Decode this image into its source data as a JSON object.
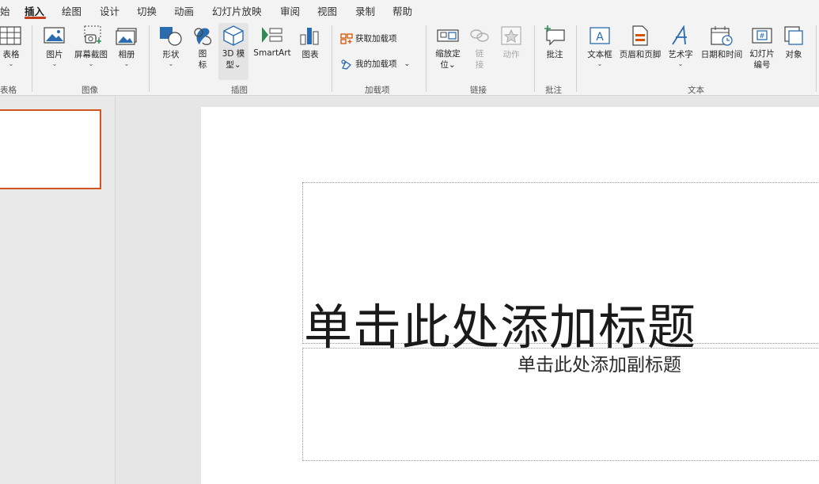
{
  "tabs": [
    {
      "label": "始",
      "active": false
    },
    {
      "label": "插入",
      "active": true
    },
    {
      "label": "绘图",
      "active": false
    },
    {
      "label": "设计",
      "active": false
    },
    {
      "label": "切换",
      "active": false
    },
    {
      "label": "动画",
      "active": false
    },
    {
      "label": "幻灯片放映",
      "active": false
    },
    {
      "label": "审阅",
      "active": false
    },
    {
      "label": "视图",
      "active": false
    },
    {
      "label": "录制",
      "active": false
    },
    {
      "label": "帮助",
      "active": false
    }
  ],
  "ribbon": {
    "groups": {
      "table": "表格",
      "images": "图像",
      "illustrations": "插图",
      "addins": "加载项",
      "links": "链接",
      "comments": "批注",
      "text": "文本"
    },
    "buttons": {
      "table": "表格",
      "pictures": "图片",
      "screenshot": "屏幕截图",
      "album": "相册",
      "shapes": "形状",
      "icons": "图\n标",
      "icons_l1": "图",
      "icons_l2": "标",
      "model3d_l1": "3D 模",
      "model3d_l2": "型",
      "smartart": "SmartArt",
      "chart": "图表",
      "get_addins": "获取加载项",
      "my_addins": "我的加载项",
      "zoom_l1": "缩放定",
      "zoom_l2": "位",
      "link_l1": "链",
      "link_l2": "接",
      "action": "动作",
      "comment": "批注",
      "textbox": "文本框",
      "header_footer": "页眉和页脚",
      "wordart": "艺术字",
      "datetime": "日期和时间",
      "slide_number_l1": "幻灯片",
      "slide_number_l2": "编号",
      "object": "对象"
    },
    "icons": {
      "table": "table-icon",
      "pictures": "picture-icon",
      "screenshot": "screenshot-icon",
      "album": "photo-album-icon",
      "shapes": "shapes-icon",
      "icons": "icons-icon",
      "model3d": "cube-icon",
      "smartart": "smartart-icon",
      "chart": "bar-chart-icon",
      "get_addins": "store-icon",
      "my_addins": "my-addins-icon",
      "zoom": "zoom-icon",
      "link": "link-icon",
      "action": "star-action-icon",
      "comment": "comment-icon",
      "textbox": "textbox-icon",
      "header_footer": "header-footer-icon",
      "wordart": "wordart-icon",
      "datetime": "calendar-icon",
      "slide_number": "slide-number-icon",
      "object": "object-icon"
    }
  },
  "slide": {
    "title_placeholder": "单击此处添加标题",
    "subtitle_placeholder": "单击此处添加副标题"
  },
  "colors": {
    "accent": "#c43e1c",
    "thumb_border": "#d3541f",
    "icon_blue": "#2b6cb0"
  }
}
